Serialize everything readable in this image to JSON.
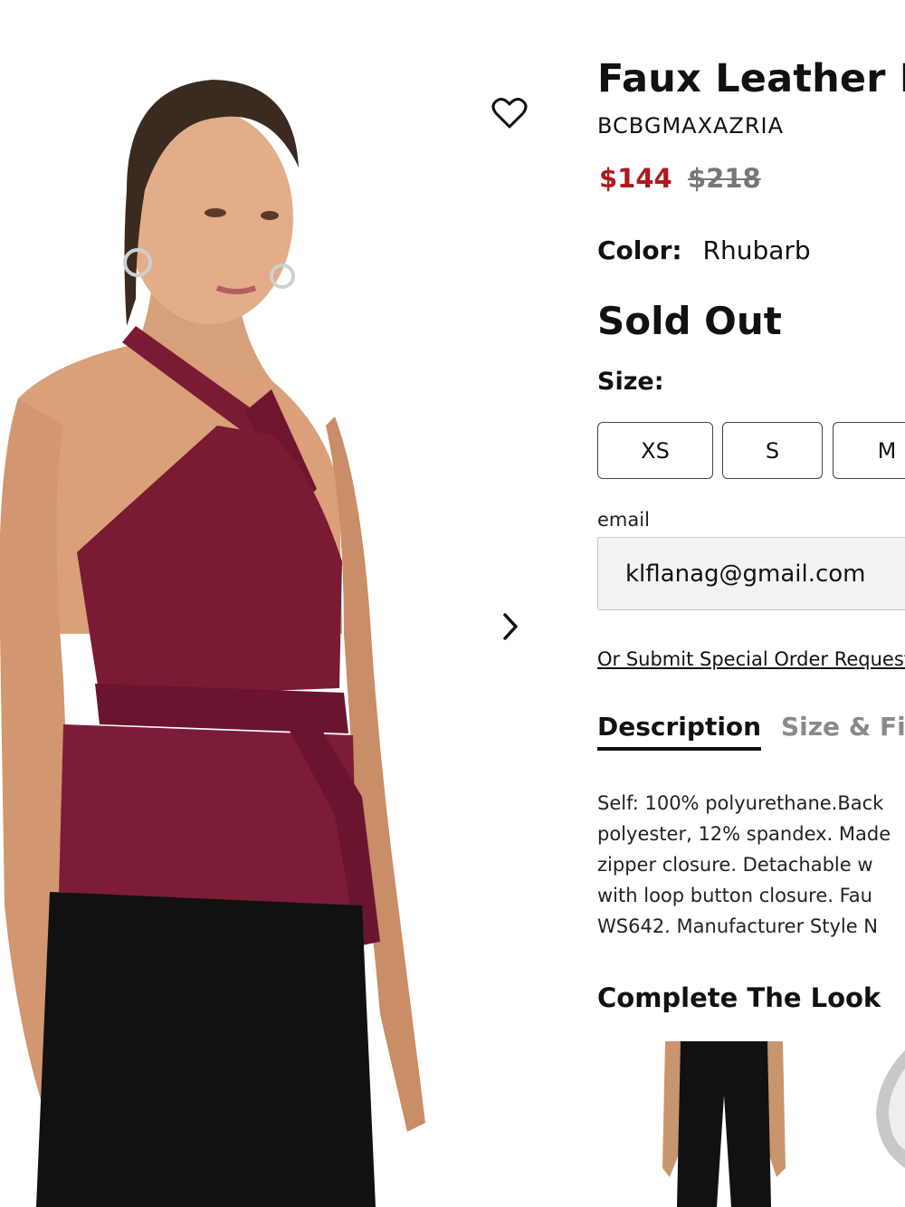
{
  "product": {
    "title": "Faux Leather Halter Top",
    "brand": "BCBGMAXAZRIA",
    "price": "$144",
    "original_price": "$218",
    "color_label": "Color:",
    "color_value": "Rhubarb",
    "availability": "Sold Out",
    "size_label": "Size:",
    "sizes": [
      "XS",
      "S",
      "M"
    ]
  },
  "notify": {
    "email_label": "email",
    "email_value": "klflanag@gmail.com",
    "special_order_link": "Or Submit Special Order Request"
  },
  "tabs": {
    "description": "Description",
    "size_fit": "Size & Fit"
  },
  "description_lines": [
    "Self: 100% polyurethane.Back",
    "polyester, 12% spandex. Made",
    "zipper closure. Detachable w",
    "with loop button closure. Fau",
    "WS642. Manufacturer Style N"
  ],
  "complete_the_look": {
    "heading": "Complete The Look"
  },
  "colors": {
    "sale_price": "#b0191e",
    "garment": "#7a1a33",
    "pants": "#111111"
  },
  "icons": {
    "wishlist": "heart-outline-icon",
    "next": "chevron-right-icon"
  }
}
